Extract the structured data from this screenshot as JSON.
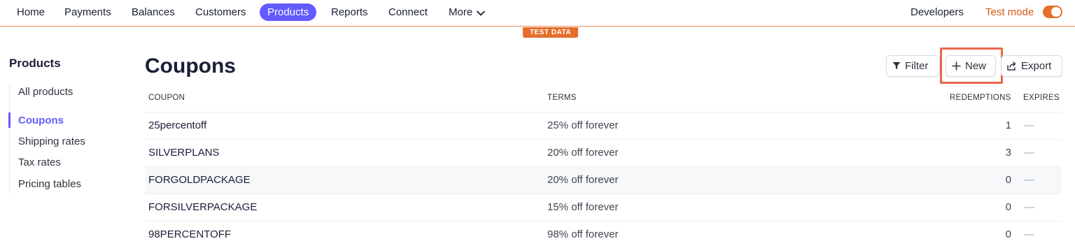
{
  "nav": {
    "items": [
      {
        "label": "Home"
      },
      {
        "label": "Payments"
      },
      {
        "label": "Balances"
      },
      {
        "label": "Customers"
      },
      {
        "label": "Products",
        "active": true
      },
      {
        "label": "Reports"
      },
      {
        "label": "Connect"
      },
      {
        "label": "More"
      }
    ],
    "developers": "Developers",
    "test_mode": "Test mode",
    "test_mode_on": true
  },
  "test_badge": "TEST DATA",
  "sidebar": {
    "title": "Products",
    "items": [
      {
        "label": "All products"
      },
      {
        "label": "Coupons",
        "active": true
      },
      {
        "label": "Shipping rates"
      },
      {
        "label": "Tax rates"
      },
      {
        "label": "Pricing tables"
      }
    ]
  },
  "main": {
    "title": "Coupons",
    "buttons": {
      "filter": "Filter",
      "new": "New",
      "export": "Export"
    },
    "columns": {
      "coupon": "COUPON",
      "terms": "TERMS",
      "redemptions": "REDEMPTIONS",
      "expires": "EXPIRES"
    },
    "rows": [
      {
        "coupon": "25percentoff",
        "terms": "25% off forever",
        "redemptions": "1",
        "expires": "—"
      },
      {
        "coupon": "SILVERPLANS",
        "terms": "20% off forever",
        "redemptions": "3",
        "expires": "—"
      },
      {
        "coupon": "FORGOLDPACKAGE",
        "terms": "20% off forever",
        "redemptions": "0",
        "expires": "—"
      },
      {
        "coupon": "FORSILVERPACKAGE",
        "terms": "15% off forever",
        "redemptions": "0",
        "expires": "—"
      },
      {
        "coupon": "98PERCENTOFF",
        "terms": "98% off forever",
        "redemptions": "0",
        "expires": "—"
      }
    ]
  },
  "colors": {
    "accent": "#635bff",
    "test_mode": "#e46e2a",
    "highlight": "#e8674a"
  }
}
